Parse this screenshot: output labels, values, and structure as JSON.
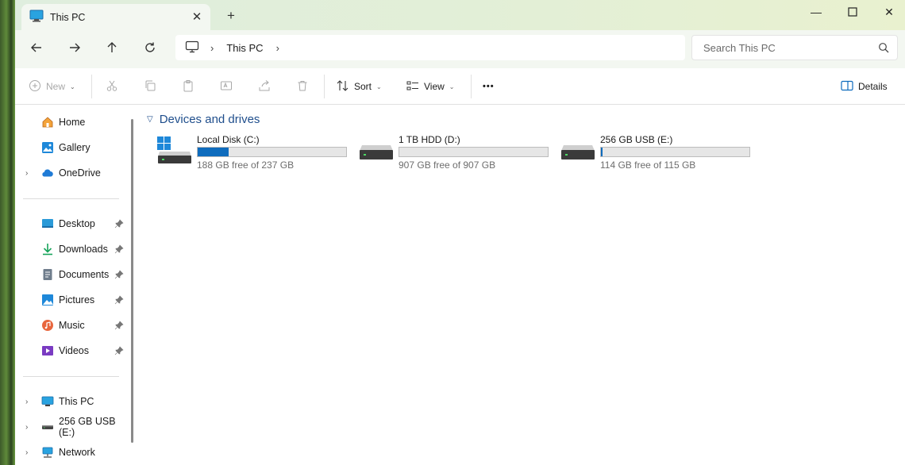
{
  "window": {
    "tab_title": "This PC",
    "minimize": "—",
    "maximize": "☐",
    "close": "✕"
  },
  "address": {
    "crumb": "This PC",
    "search_placeholder": "Search This PC"
  },
  "commands": {
    "new": "New",
    "sort": "Sort",
    "view": "View",
    "more": "•••",
    "details": "Details"
  },
  "sidebar": {
    "top": [
      {
        "label": "Home",
        "icon": "home-icon"
      },
      {
        "label": "Gallery",
        "icon": "gallery-icon"
      },
      {
        "label": "OneDrive",
        "icon": "onedrive-icon"
      }
    ],
    "quick": [
      {
        "label": "Desktop",
        "icon": "desktop-icon"
      },
      {
        "label": "Downloads",
        "icon": "download-icon"
      },
      {
        "label": "Documents",
        "icon": "documents-icon"
      },
      {
        "label": "Pictures",
        "icon": "pictures-icon"
      },
      {
        "label": "Music",
        "icon": "music-icon"
      },
      {
        "label": "Videos",
        "icon": "videos-icon"
      }
    ],
    "bottom": [
      {
        "label": "This PC",
        "icon": "pc-icon"
      },
      {
        "label": "256 GB USB (E:)",
        "icon": "usb-drive-icon"
      },
      {
        "label": "Network",
        "icon": "network-icon"
      }
    ]
  },
  "content": {
    "group_title": "Devices and drives",
    "drives": [
      {
        "name": "Local Disk (C:)",
        "free_text": "188 GB free of 237 GB",
        "used_fraction": 0.207
      },
      {
        "name": "1 TB HDD (D:)",
        "free_text": "907 GB free of 907 GB",
        "used_fraction": 0.0
      },
      {
        "name": "256 GB USB (E:)",
        "free_text": "114 GB free of 115 GB",
        "used_fraction": 0.009
      }
    ]
  },
  "colors": {
    "accent": "#0f6cbd",
    "group_header": "#1f4e8c"
  }
}
